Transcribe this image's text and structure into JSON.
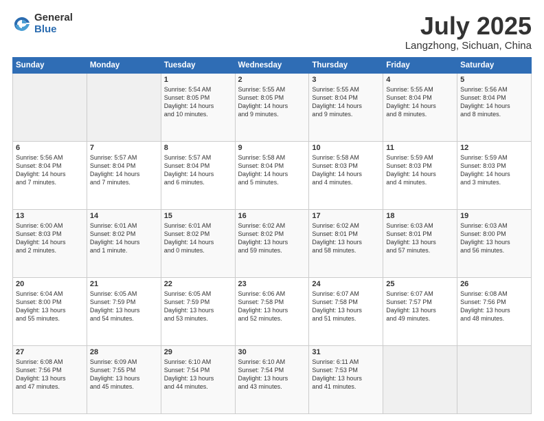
{
  "header": {
    "logo_line1": "General",
    "logo_line2": "Blue",
    "month_title": "July 2025",
    "subtitle": "Langzhong, Sichuan, China"
  },
  "days_of_week": [
    "Sunday",
    "Monday",
    "Tuesday",
    "Wednesday",
    "Thursday",
    "Friday",
    "Saturday"
  ],
  "weeks": [
    [
      {
        "day": "",
        "info": ""
      },
      {
        "day": "",
        "info": ""
      },
      {
        "day": "1",
        "info": "Sunrise: 5:54 AM\nSunset: 8:05 PM\nDaylight: 14 hours\nand 10 minutes."
      },
      {
        "day": "2",
        "info": "Sunrise: 5:55 AM\nSunset: 8:05 PM\nDaylight: 14 hours\nand 9 minutes."
      },
      {
        "day": "3",
        "info": "Sunrise: 5:55 AM\nSunset: 8:04 PM\nDaylight: 14 hours\nand 9 minutes."
      },
      {
        "day": "4",
        "info": "Sunrise: 5:55 AM\nSunset: 8:04 PM\nDaylight: 14 hours\nand 8 minutes."
      },
      {
        "day": "5",
        "info": "Sunrise: 5:56 AM\nSunset: 8:04 PM\nDaylight: 14 hours\nand 8 minutes."
      }
    ],
    [
      {
        "day": "6",
        "info": "Sunrise: 5:56 AM\nSunset: 8:04 PM\nDaylight: 14 hours\nand 7 minutes."
      },
      {
        "day": "7",
        "info": "Sunrise: 5:57 AM\nSunset: 8:04 PM\nDaylight: 14 hours\nand 7 minutes."
      },
      {
        "day": "8",
        "info": "Sunrise: 5:57 AM\nSunset: 8:04 PM\nDaylight: 14 hours\nand 6 minutes."
      },
      {
        "day": "9",
        "info": "Sunrise: 5:58 AM\nSunset: 8:04 PM\nDaylight: 14 hours\nand 5 minutes."
      },
      {
        "day": "10",
        "info": "Sunrise: 5:58 AM\nSunset: 8:03 PM\nDaylight: 14 hours\nand 4 minutes."
      },
      {
        "day": "11",
        "info": "Sunrise: 5:59 AM\nSunset: 8:03 PM\nDaylight: 14 hours\nand 4 minutes."
      },
      {
        "day": "12",
        "info": "Sunrise: 5:59 AM\nSunset: 8:03 PM\nDaylight: 14 hours\nand 3 minutes."
      }
    ],
    [
      {
        "day": "13",
        "info": "Sunrise: 6:00 AM\nSunset: 8:03 PM\nDaylight: 14 hours\nand 2 minutes."
      },
      {
        "day": "14",
        "info": "Sunrise: 6:01 AM\nSunset: 8:02 PM\nDaylight: 14 hours\nand 1 minute."
      },
      {
        "day": "15",
        "info": "Sunrise: 6:01 AM\nSunset: 8:02 PM\nDaylight: 14 hours\nand 0 minutes."
      },
      {
        "day": "16",
        "info": "Sunrise: 6:02 AM\nSunset: 8:02 PM\nDaylight: 13 hours\nand 59 minutes."
      },
      {
        "day": "17",
        "info": "Sunrise: 6:02 AM\nSunset: 8:01 PM\nDaylight: 13 hours\nand 58 minutes."
      },
      {
        "day": "18",
        "info": "Sunrise: 6:03 AM\nSunset: 8:01 PM\nDaylight: 13 hours\nand 57 minutes."
      },
      {
        "day": "19",
        "info": "Sunrise: 6:03 AM\nSunset: 8:00 PM\nDaylight: 13 hours\nand 56 minutes."
      }
    ],
    [
      {
        "day": "20",
        "info": "Sunrise: 6:04 AM\nSunset: 8:00 PM\nDaylight: 13 hours\nand 55 minutes."
      },
      {
        "day": "21",
        "info": "Sunrise: 6:05 AM\nSunset: 7:59 PM\nDaylight: 13 hours\nand 54 minutes."
      },
      {
        "day": "22",
        "info": "Sunrise: 6:05 AM\nSunset: 7:59 PM\nDaylight: 13 hours\nand 53 minutes."
      },
      {
        "day": "23",
        "info": "Sunrise: 6:06 AM\nSunset: 7:58 PM\nDaylight: 13 hours\nand 52 minutes."
      },
      {
        "day": "24",
        "info": "Sunrise: 6:07 AM\nSunset: 7:58 PM\nDaylight: 13 hours\nand 51 minutes."
      },
      {
        "day": "25",
        "info": "Sunrise: 6:07 AM\nSunset: 7:57 PM\nDaylight: 13 hours\nand 49 minutes."
      },
      {
        "day": "26",
        "info": "Sunrise: 6:08 AM\nSunset: 7:56 PM\nDaylight: 13 hours\nand 48 minutes."
      }
    ],
    [
      {
        "day": "27",
        "info": "Sunrise: 6:08 AM\nSunset: 7:56 PM\nDaylight: 13 hours\nand 47 minutes."
      },
      {
        "day": "28",
        "info": "Sunrise: 6:09 AM\nSunset: 7:55 PM\nDaylight: 13 hours\nand 45 minutes."
      },
      {
        "day": "29",
        "info": "Sunrise: 6:10 AM\nSunset: 7:54 PM\nDaylight: 13 hours\nand 44 minutes."
      },
      {
        "day": "30",
        "info": "Sunrise: 6:10 AM\nSunset: 7:54 PM\nDaylight: 13 hours\nand 43 minutes."
      },
      {
        "day": "31",
        "info": "Sunrise: 6:11 AM\nSunset: 7:53 PM\nDaylight: 13 hours\nand 41 minutes."
      },
      {
        "day": "",
        "info": ""
      },
      {
        "day": "",
        "info": ""
      }
    ]
  ]
}
